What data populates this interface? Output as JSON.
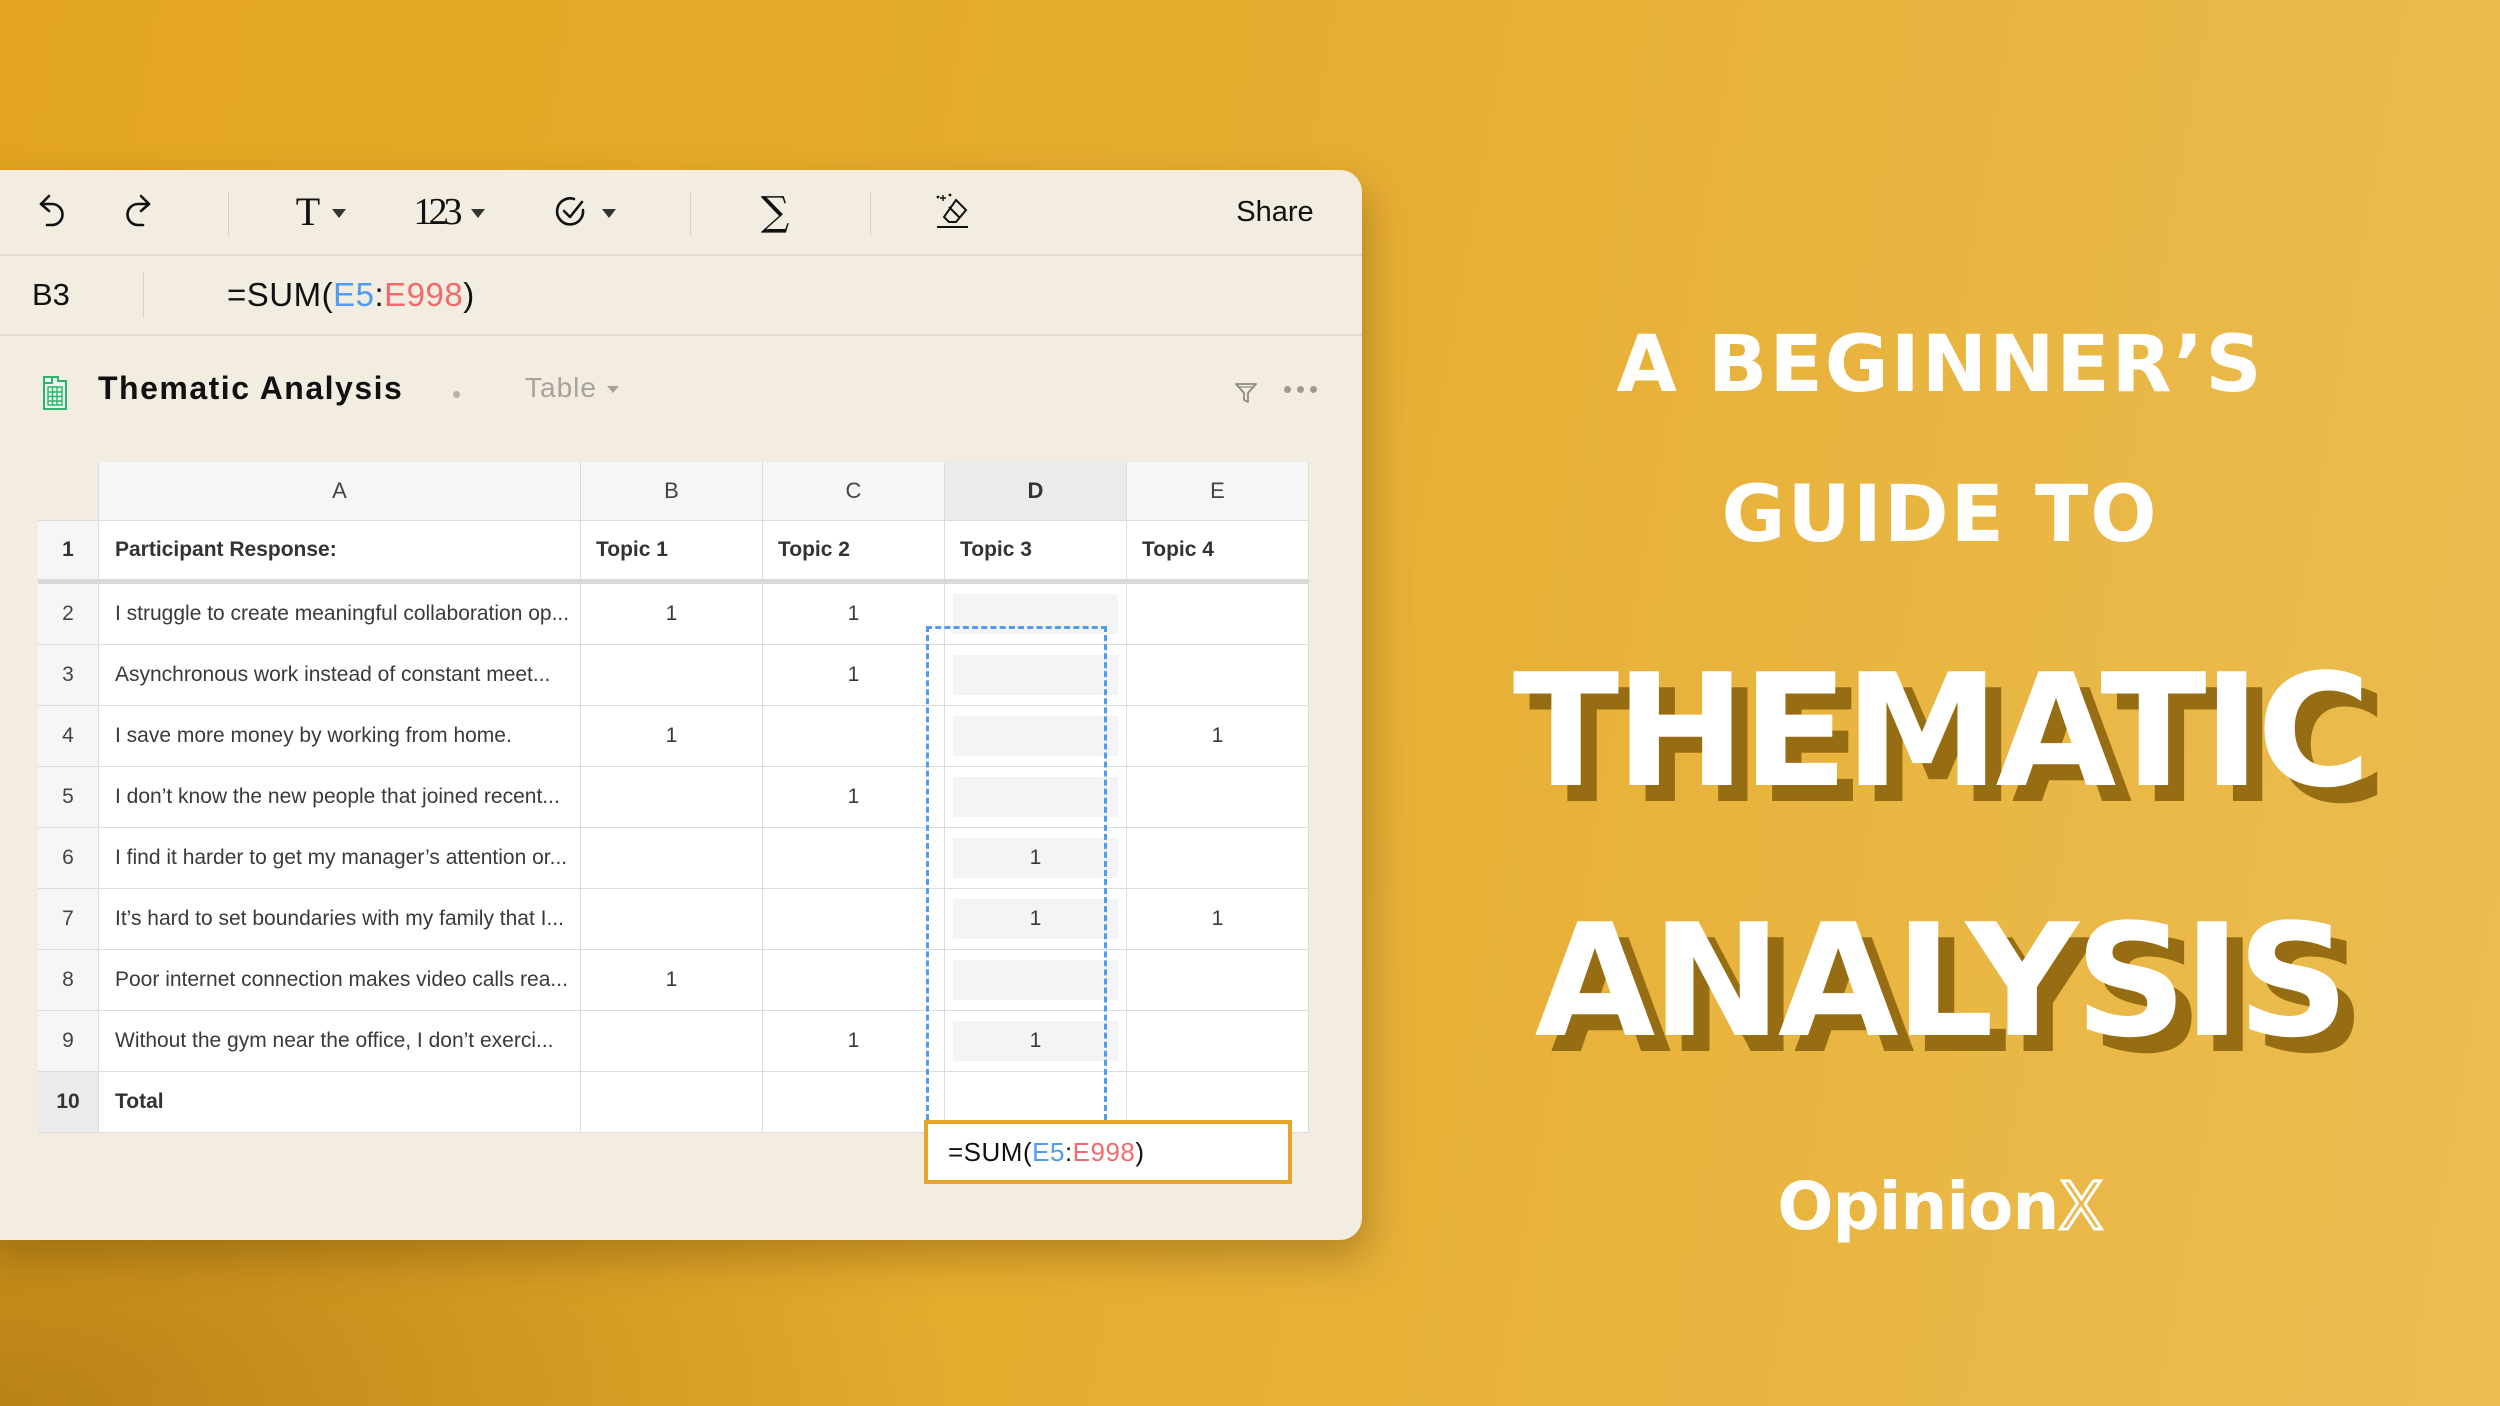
{
  "toolbar": {
    "undo_icon": "undo-icon",
    "redo_icon": "redo-icon",
    "text_format_label": "T",
    "number_format_label": "123",
    "validation_icon": "check-circle-icon",
    "sum_label": "∑",
    "clear_format_icon": "eraser-icon",
    "share_label": "Share"
  },
  "formula_bar": {
    "cell_ref": "B3",
    "formula_prefix": "=SUM(",
    "range_start": "E5",
    "range_sep": ":",
    "range_end": "E998",
    "formula_suffix": ")"
  },
  "sheet": {
    "title": "Thematic Analysis",
    "view_label": "Table",
    "icon": "spreadsheet-icon",
    "filter_icon": "filter-icon",
    "more_icon": "more-icon"
  },
  "grid": {
    "column_letters": [
      "A",
      "B",
      "C",
      "D",
      "E"
    ],
    "selected_column": "D",
    "header_row": {
      "row_number": "1",
      "cells": [
        "Participant Response:",
        "Topic 1",
        "Topic 2",
        "Topic 3",
        "Topic 4"
      ]
    },
    "rows": [
      {
        "row_number": "2",
        "cells": [
          "I struggle to create meaningful collaboration op...",
          "1",
          "1",
          "",
          ""
        ]
      },
      {
        "row_number": "3",
        "cells": [
          "Asynchronous work instead of constant meet...",
          "",
          "1",
          "",
          ""
        ]
      },
      {
        "row_number": "4",
        "cells": [
          "I save more money by working from home.",
          "1",
          "",
          "",
          "1"
        ]
      },
      {
        "row_number": "5",
        "cells": [
          "I don’t know the new people that joined recent...",
          "",
          "1",
          "",
          ""
        ]
      },
      {
        "row_number": "6",
        "cells": [
          "I find it harder to get my manager’s attention or...",
          "",
          "",
          "1",
          ""
        ]
      },
      {
        "row_number": "7",
        "cells": [
          "It’s hard to set boundaries with my family that I...",
          "",
          "",
          "1",
          "1"
        ]
      },
      {
        "row_number": "8",
        "cells": [
          "Poor internet connection makes video calls rea...",
          "1",
          "",
          "",
          ""
        ]
      },
      {
        "row_number": "9",
        "cells": [
          "Without the gym near the office, I don’t exerci...",
          "",
          "1",
          "1",
          ""
        ]
      }
    ],
    "total_row": {
      "row_number": "10",
      "label": "Total"
    },
    "active_cell_formula": {
      "prefix": "=SUM(",
      "range_start": "E5",
      "sep": ":",
      "range_end": "E998",
      "suffix": ")"
    }
  },
  "promo": {
    "line1": "A BEGINNER’S",
    "line2": "GUIDE TO",
    "title_line1": "THEMATIC",
    "title_line2": "ANALYSIS",
    "brand_main": "Opinion",
    "brand_x": "X"
  },
  "colors": {
    "background": "#e6ad2f",
    "card": "#f3ede1",
    "range_start": "#4f9cf0",
    "range_end": "#f06c6c",
    "active_cell_border": "#e5a52a",
    "title_shadow": "#966d12"
  }
}
